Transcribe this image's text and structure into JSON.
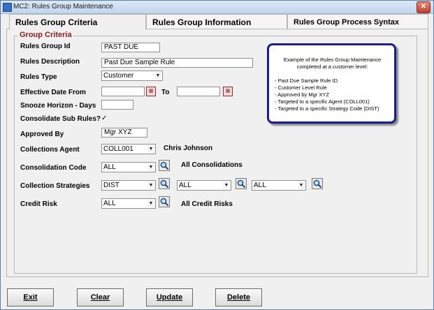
{
  "window": {
    "title": "MC2: Rules Group Maintenance",
    "close_label": "✕"
  },
  "tabs": [
    {
      "label": "Rules Group Criteria",
      "active": true
    },
    {
      "label": "Rules Group Information",
      "active": false
    },
    {
      "label": "Rules Group Process Syntax",
      "active": false
    }
  ],
  "group": {
    "legend": "Group Criteria"
  },
  "form": {
    "rules_group_id": {
      "label": "Rules Group Id",
      "value": "PAST DUE"
    },
    "rules_description": {
      "label": "Rules Description",
      "value": "Past Due Sample Rule"
    },
    "rules_type": {
      "label": "Rules Type",
      "value": "Customer"
    },
    "effective_date": {
      "label": "Effective Date From",
      "to_label": "To",
      "from_value": "",
      "to_value": ""
    },
    "snooze": {
      "label": "Snooze Horizon - Days",
      "value": ""
    },
    "consolidate": {
      "label": "Consolidate Sub Rules?",
      "checked": "✓"
    },
    "approved_by": {
      "label": "Approved By",
      "value": "Mgr XYZ"
    },
    "collections_agent": {
      "label": "Collections Agent",
      "value": "COLL001",
      "name": "Chris Johnson"
    },
    "consolidation_code": {
      "label": "Consolidation Code",
      "value": "ALL",
      "description": "All Consolidations"
    },
    "collection_strategies": {
      "label": "Collection Strategies",
      "value1": "DIST",
      "value2": "ALL",
      "value3": "ALL"
    },
    "credit_risk": {
      "label": "Credit Risk",
      "value": "ALL",
      "description": "All Credit Risks"
    }
  },
  "info": {
    "title": "Example of the Rules Group Maintenance completed at a customer level:",
    "items": [
      "- Past Due Sample Rule ID",
      "- Customer Level Rule",
      "- Approved by Mgr XYZ",
      "- Targeted to a specific Agent (COLL001)",
      "- Targeted to a specific Strategy Code (DIST)"
    ]
  },
  "buttons": {
    "exit": "Exit",
    "clear": "Clear",
    "update": "Update",
    "delete": "Delete"
  },
  "icons": {
    "lookup": "magnifier-icon",
    "calendar": "calendar-icon",
    "dropdown": "chevron-down-icon"
  },
  "colors": {
    "legend": "#8b1a1a",
    "info_border": "#1c1c8c",
    "title_bar": "#c3d6ec"
  }
}
